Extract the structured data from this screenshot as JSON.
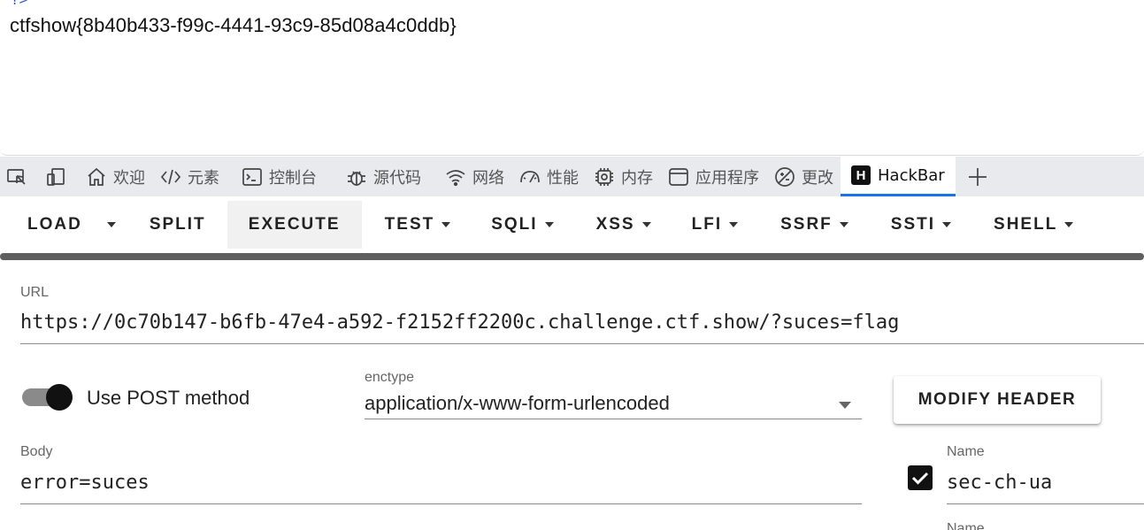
{
  "page": {
    "prev_line": "?>",
    "flag_text": "ctfshow{8b40b433-f99c-4441-93c9-85d08a4c0ddb}"
  },
  "devtools_tabs": [
    {
      "name": "inspect",
      "label": "",
      "icon": "inspect-icon"
    },
    {
      "name": "device",
      "label": "",
      "icon": "device-icon"
    },
    {
      "name": "welcome",
      "label": "欢迎",
      "icon": "home-icon"
    },
    {
      "name": "elements",
      "label": "元素",
      "icon": "code-icon"
    },
    {
      "name": "console",
      "label": "控制台",
      "icon": "console-icon"
    },
    {
      "name": "sources",
      "label": "源代码",
      "icon": "bug-icon"
    },
    {
      "name": "network",
      "label": "网络",
      "icon": "wifi-icon"
    },
    {
      "name": "performance",
      "label": "性能",
      "icon": "gauge-icon"
    },
    {
      "name": "memory",
      "label": "内存",
      "icon": "chip-icon"
    },
    {
      "name": "application",
      "label": "应用程序",
      "icon": "window-icon"
    },
    {
      "name": "changes",
      "label": "更改",
      "icon": "changes-icon"
    },
    {
      "name": "hackbar",
      "label": "HackBar",
      "icon": "hackbar-logo",
      "active": true
    },
    {
      "name": "add",
      "label": "",
      "icon": "plus-icon"
    }
  ],
  "hackbar_logo_letter": "H",
  "toolbar": {
    "load": "LOAD",
    "split": "SPLIT",
    "execute": "EXECUTE",
    "test": "TEST",
    "sqli": "SQLI",
    "xss": "XSS",
    "lfi": "LFI",
    "ssrf": "SSRF",
    "ssti": "SSTI",
    "shell": "SHELL"
  },
  "url": {
    "label": "URL",
    "value": "https://0c70b147-b6fb-47e4-a592-f2152ff2200c.challenge.ctf.show/?suces=flag"
  },
  "post": {
    "label": "Use POST method",
    "enabled": true
  },
  "enctype": {
    "label": "enctype",
    "value": "application/x-www-form-urlencoded"
  },
  "modify_header_label": "MODIFY HEADER",
  "body": {
    "label": "Body",
    "value": "error=suces"
  },
  "header_row": {
    "checked": true,
    "name_label": "Name",
    "name_value": "sec-ch-ua",
    "next_name_label": "Name"
  }
}
